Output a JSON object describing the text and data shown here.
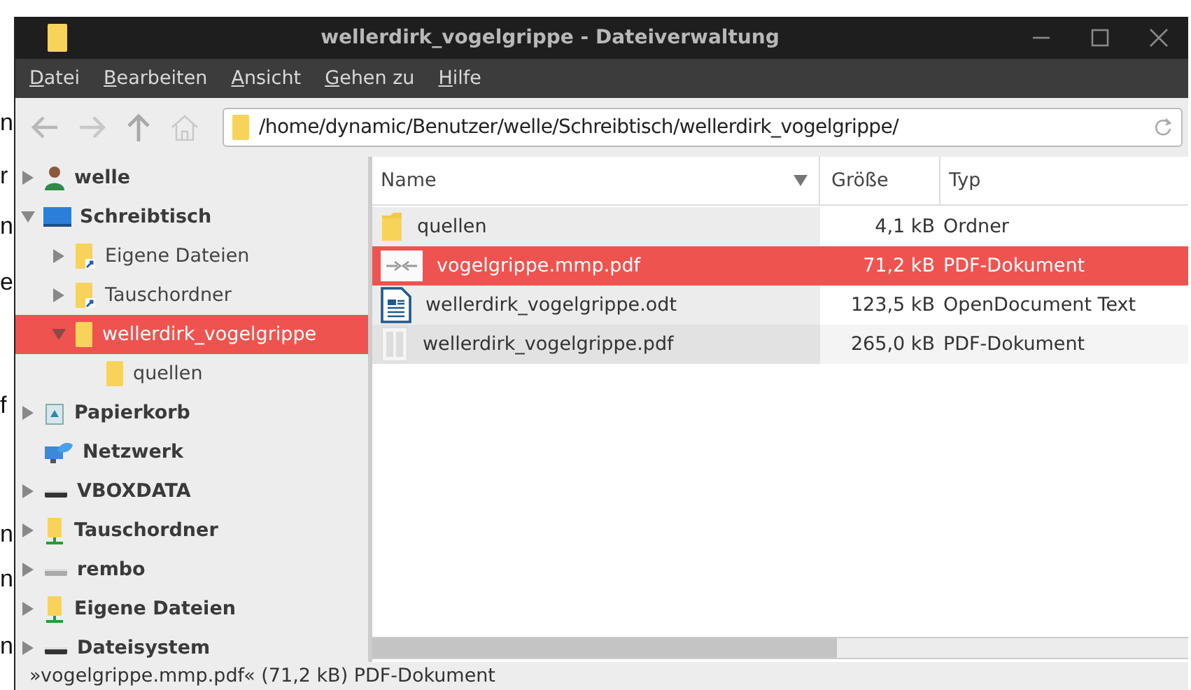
{
  "background_fragments": [
    "n",
    "r",
    "n",
    "e",
    "f",
    "n",
    "n",
    "n"
  ],
  "window": {
    "title": "wellerdirk_vogelgrippe - Dateiverwaltung"
  },
  "menu": [
    "Datei",
    "Bearbeiten",
    "Ansicht",
    "Gehen zu",
    "Hilfe"
  ],
  "location": {
    "value": "/home/dynamic/Benutzer/welle/Schreibtisch/wellerdirk_vogelgrippe/"
  },
  "sidebar": {
    "items": [
      {
        "label": "welle",
        "kind": "user",
        "expanded": false,
        "selected": false
      },
      {
        "label": "Schreibtisch",
        "kind": "desktop",
        "expanded": true,
        "selected": false,
        "children": [
          {
            "label": "Eigene Dateien",
            "kind": "link",
            "expanded": false,
            "selected": false
          },
          {
            "label": "Tauschordner",
            "kind": "link",
            "expanded": false,
            "selected": false
          },
          {
            "label": "wellerdirk_vogelgrippe",
            "kind": "folder",
            "expanded": true,
            "selected": true,
            "children": [
              {
                "label": "quellen",
                "kind": "folder",
                "selected": false
              }
            ]
          }
        ]
      },
      {
        "label": "Papierkorb",
        "kind": "trash",
        "expanded": false,
        "selected": false
      },
      {
        "label": "Netzwerk",
        "kind": "network",
        "selected": false
      },
      {
        "label": "VBOXDATA",
        "kind": "drive",
        "expanded": false,
        "selected": false
      },
      {
        "label": "Tauschordner",
        "kind": "share",
        "expanded": false,
        "selected": false
      },
      {
        "label": "rembo",
        "kind": "drive2",
        "expanded": false,
        "selected": false
      },
      {
        "label": "Eigene Dateien",
        "kind": "share",
        "expanded": false,
        "selected": false
      },
      {
        "label": "Dateisystem",
        "kind": "drive",
        "expanded": false,
        "selected": false
      }
    ]
  },
  "table": {
    "columns": [
      "Name",
      "Größe",
      "Typ"
    ],
    "rows": [
      {
        "name": "quellen",
        "size": "4,1 kB",
        "type": "Ordner",
        "kind": "folder",
        "selected": false
      },
      {
        "name": "vogelgrippe.mmp.pdf",
        "size": "71,2 kB",
        "type": "PDF-Dokument",
        "kind": "preview",
        "selected": true
      },
      {
        "name": "wellerdirk_vogelgrippe.odt",
        "size": "123,5 kB",
        "type": "OpenDocument Text",
        "kind": "odt",
        "selected": false
      },
      {
        "name": "wellerdirk_vogelgrippe.pdf",
        "size": "265,0 kB",
        "type": "PDF-Dokument",
        "kind": "pdf",
        "selected": false
      }
    ]
  },
  "status_bar": "»vogelgrippe.mmp.pdf« (71,2 kB) PDF-Dokument"
}
